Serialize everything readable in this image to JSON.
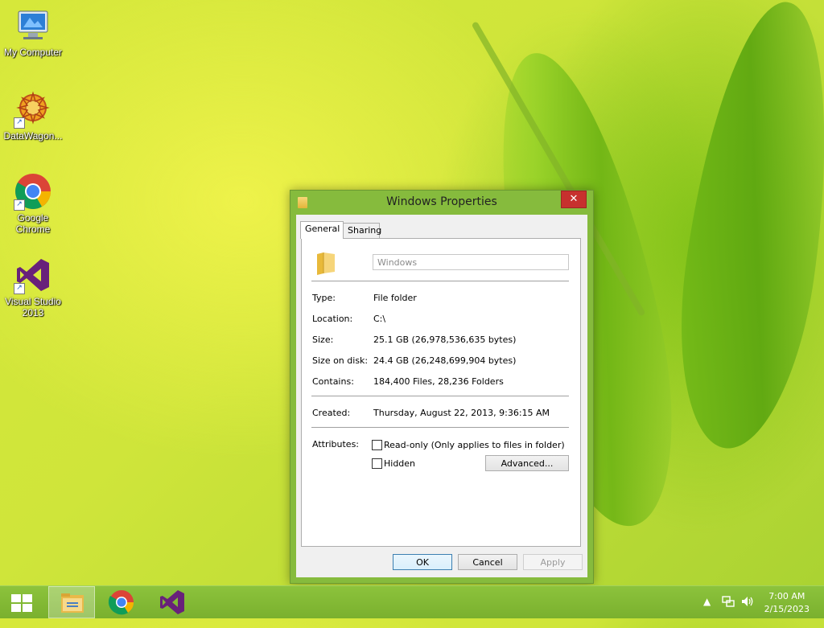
{
  "desktop": {
    "icons": [
      {
        "label": "My Computer",
        "icon": "computer-icon"
      },
      {
        "label": "DataWagon...",
        "icon": "datawagon-icon"
      },
      {
        "label": "Google Chrome",
        "icon": "chrome-icon"
      },
      {
        "label": "Visual Studio 2013",
        "icon": "visual-studio-icon"
      }
    ]
  },
  "dialog": {
    "title": "Windows Properties",
    "close_glyph": "✕",
    "tabs": [
      {
        "label": "General"
      },
      {
        "label": "Sharing"
      }
    ],
    "active_tab": "General",
    "folder_name": "Windows",
    "rows": {
      "type": {
        "label": "Type:",
        "value": "File folder"
      },
      "location": {
        "label": "Location:",
        "value": "C:\\"
      },
      "size": {
        "label": "Size:",
        "value": "25.1 GB (26,978,536,635 bytes)"
      },
      "size_on_disk": {
        "label": "Size on disk:",
        "value": "24.4 GB (26,248,699,904 bytes)"
      },
      "contains": {
        "label": "Contains:",
        "value": "184,400 Files, 28,236 Folders"
      },
      "created": {
        "label": "Created:",
        "value": "Thursday, August 22, 2013, 9:36:15 AM"
      }
    },
    "attributes": {
      "label": "Attributes:",
      "readonly_label": "Read-only (Only applies to files in folder)",
      "readonly_checked": false,
      "hidden_label": "Hidden",
      "hidden_checked": false,
      "advanced_label": "Advanced..."
    },
    "buttons": {
      "ok": "OK",
      "cancel": "Cancel",
      "apply": "Apply"
    }
  },
  "taskbar": {
    "items": [
      {
        "name": "file-explorer",
        "icon": "folder-icon"
      },
      {
        "name": "chrome",
        "icon": "chrome-icon"
      },
      {
        "name": "visual-studio",
        "icon": "visual-studio-icon"
      }
    ],
    "tray": {
      "chevron": "▲",
      "network_icon": "network-icon",
      "volume_icon": "volume-icon"
    },
    "clock": {
      "time": "7:00 AM",
      "date": "2/15/2023"
    }
  },
  "colors": {
    "accent": "#86bb3d",
    "close": "#c7302e",
    "taskbar": "#7ab02e"
  }
}
